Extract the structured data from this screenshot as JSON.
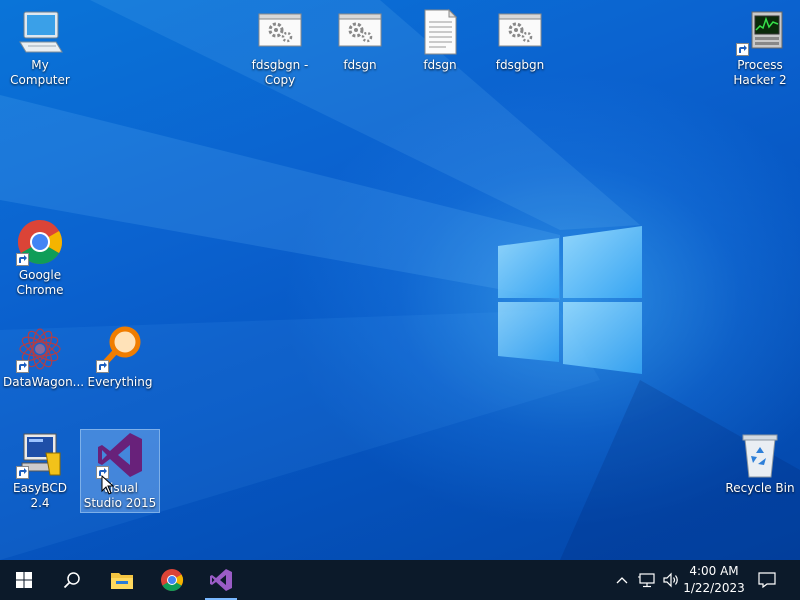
{
  "desktop": {
    "icons": [
      {
        "name": "my-computer",
        "label": "My Computer",
        "icon": "computer-icon"
      },
      {
        "name": "fdsgbgn-copy",
        "label": "fdsgbgn - Copy",
        "icon": "settings-file-icon"
      },
      {
        "name": "fdsgn-1",
        "label": "fdsgn",
        "icon": "settings-file-icon"
      },
      {
        "name": "fdsgn-2",
        "label": "fdsgn",
        "icon": "text-document-icon"
      },
      {
        "name": "fdsgbgn",
        "label": "fdsgbgn",
        "icon": "settings-file-icon"
      },
      {
        "name": "process-hacker",
        "label": "Process Hacker 2",
        "icon": "process-hacker-icon",
        "shortcut": true
      },
      {
        "name": "google-chrome",
        "label": "Google Chrome",
        "icon": "chrome-icon",
        "shortcut": true
      },
      {
        "name": "datawagon",
        "label": "DataWagon...",
        "icon": "datawagon-icon",
        "shortcut": true
      },
      {
        "name": "everything",
        "label": "Everything",
        "icon": "everything-search-icon",
        "shortcut": true
      },
      {
        "name": "easybcd",
        "label": "EasyBCD 2.4",
        "icon": "easybcd-icon",
        "shortcut": true
      },
      {
        "name": "visual-studio",
        "label": "Visual Studio 2015",
        "icon": "visual-studio-icon",
        "shortcut": true,
        "selected": true
      },
      {
        "name": "recycle-bin",
        "label": "Recycle Bin",
        "icon": "recycle-bin-icon"
      }
    ]
  },
  "taskbar": {
    "buttons": [
      "start-icon",
      "search-icon",
      "file-explorer-icon",
      "chrome-icon",
      "visual-studio-icon"
    ],
    "tray": [
      "chevron-up-icon",
      "network-icon",
      "volume-icon"
    ],
    "clock": {
      "time": "4:00 AM",
      "date": "1/22/2023"
    },
    "notification_icon": "action-center-icon"
  },
  "colors": {
    "desktop_blue": "#0b62cf",
    "taskbar": "#0c1a2a",
    "visual_studio_purple": "#68217a"
  }
}
